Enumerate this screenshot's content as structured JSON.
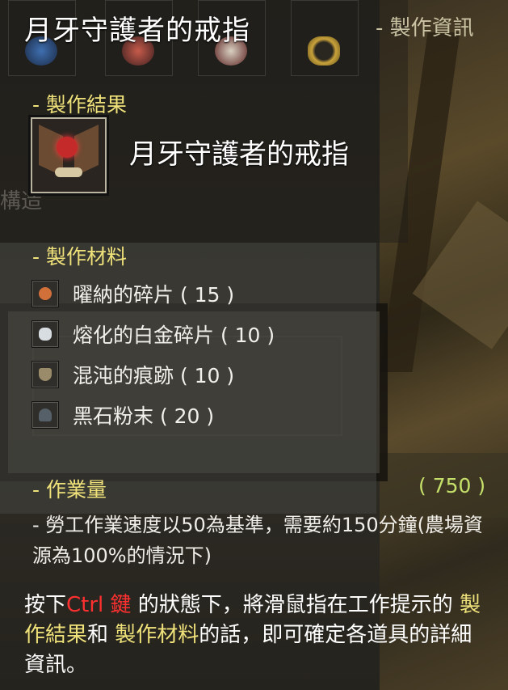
{
  "window": {
    "title": "月牙守護者的戒指",
    "info_link": "- 製作資訊"
  },
  "background": {
    "ghost_text": "構造"
  },
  "top_slots": [
    {
      "icon": "ring-item-icon-1"
    },
    {
      "icon": "scroll-item-icon"
    },
    {
      "icon": "capsule-item-icon"
    },
    {
      "icon": "necklace-item-icon"
    }
  ],
  "result": {
    "section_title": "- 製作結果",
    "item_icon": "crest-ring-icon",
    "item_name": "月牙守護者的戒指"
  },
  "materials": {
    "section_title": "- 製作材料",
    "items": [
      {
        "label": "曜納的碎片 ( 15 )",
        "icon": "orange-orb-icon",
        "color": "#d2703a"
      },
      {
        "label": "熔化的白金碎片 ( 10 )",
        "icon": "silver-piece-icon",
        "color": "#d8dde2"
      },
      {
        "label": "混沌的痕跡 ( 10 )",
        "icon": "dark-mark-icon",
        "color": "#9a8c6a"
      },
      {
        "label": "黑石粉末 ( 20 )",
        "icon": "black-powder-icon",
        "color": "#556068"
      }
    ]
  },
  "workload": {
    "section_title": "- 作業量",
    "value": "( 750 )",
    "description": "- 勞工作業速度以50為基準，需要約150分鐘(農場資源為100%的情況下)"
  },
  "hint": {
    "p1": "按下",
    "key": "Ctrl 鍵",
    "p2": " 的狀態下，將滑鼠指在工作提示的 ",
    "term1": "製作結果",
    "p3": "和 ",
    "term2": "製作材料",
    "p4": "的話，即可確定各道具的詳細資訊。"
  },
  "colors": {
    "title": "#ffffff",
    "section": "#f0e27a",
    "quantity": "#c5e06a",
    "key_highlight": "#ff3030"
  }
}
